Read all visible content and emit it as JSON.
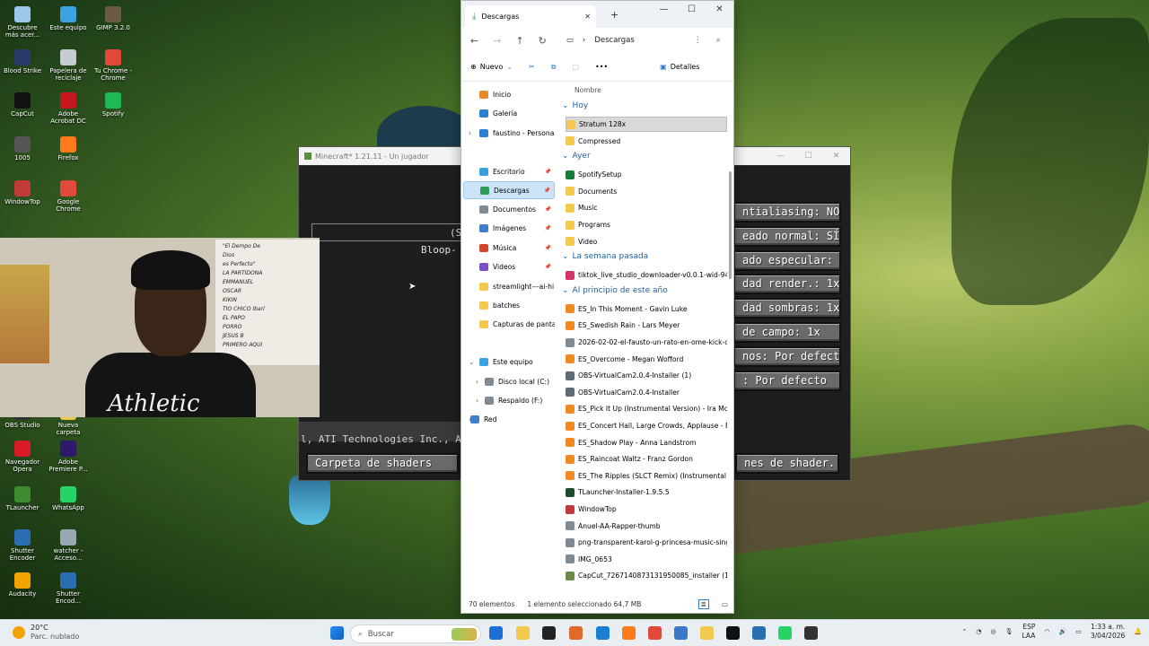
{
  "desktop_icons": [
    {
      "label": "Descubre más acer...",
      "color": "#9cc7e8"
    },
    {
      "label": "Este equipo",
      "color": "#3da2e0"
    },
    {
      "label": "GIMP 3.2.0",
      "color": "#6c5a42"
    },
    {
      "label": "Blood Strike",
      "color": "#2a3a6a"
    },
    {
      "label": "Papelera de reciclaje",
      "color": "#c7ccd3"
    },
    {
      "label": "Tu Chrome - Chrome",
      "color": "#e3493a"
    },
    {
      "label": "CapCut",
      "color": "#111111"
    },
    {
      "label": "Adobe Acrobat DC",
      "color": "#c8161d"
    },
    {
      "label": "Spotify",
      "color": "#1db954"
    },
    {
      "label": "1005",
      "color": "#555555"
    },
    {
      "label": "Firefox",
      "color": "#ff7a1a"
    },
    {
      "label": "WindowTop",
      "color": "#c23b3b"
    },
    {
      "label": "Google Chrome",
      "color": "#e3493a"
    },
    {
      "label": "OBS Studio",
      "color": "#303030"
    },
    {
      "label": "Nueva carpeta",
      "color": "#f2c94c"
    },
    {
      "label": "Navegador Opera",
      "color": "#d81b26"
    },
    {
      "label": "Adobe Premiere P...",
      "color": "#2d1a6b"
    },
    {
      "label": "TLauncher",
      "color": "#3c8b2f"
    },
    {
      "label": "WhatsApp",
      "color": "#25d366"
    },
    {
      "label": "Shutter Encoder",
      "color": "#2a6db0"
    },
    {
      "label": "watcher - Acceso...",
      "color": "#9aa8b4"
    },
    {
      "label": "Audacity",
      "color": "#f3a300"
    },
    {
      "label": "Shutter Encod...",
      "color": "#2a6db0"
    }
  ],
  "minecraft": {
    "title": "Minecraft* 1.21.11 - Un jugador",
    "text_top": "(SH",
    "text_bloop": "Bloop-",
    "text_gpu": "l, ATI Technologies Inc., AM",
    "left_button": "Carpeta de shaders",
    "options": [
      "ntialiasing: NO",
      "eado normal: SÍ",
      "ado especular: SÍ",
      "dad render.: 1x",
      "dad sombras: 1x",
      "de campo: 1x",
      "nos: Por defecto",
      ": Por defecto"
    ],
    "right_button": "nes de shader..."
  },
  "webcam": {
    "poster_lines": [
      "\"El Dempo De",
      "Dios",
      "es Perfecto\"",
      "LA PARTIDONA",
      "EMMANUEL",
      "OSCAR",
      "KIKIN",
      "TIO CHICO Ibarí",
      "EL PAPO",
      "PORRO",
      "JESUS B",
      "PRIMERO AQUI"
    ],
    "shirt": "Athletic"
  },
  "explorer": {
    "tab_title": "Descargas",
    "path": "Descargas",
    "new_label": "Nuevo",
    "details_label": "Detalles",
    "column_name": "Nombre",
    "nav": [
      {
        "label": "Inicio",
        "color": "#e58b2e",
        "pin": false
      },
      {
        "label": "Galería",
        "color": "#2f7fd1",
        "pin": false
      },
      {
        "label": "faustino - Personal",
        "color": "#2f7fd1",
        "pin": false
      },
      {
        "label": "Escritorio",
        "color": "#3aa0e0",
        "pin": true
      },
      {
        "label": "Descargas",
        "color": "#2e9c58",
        "pin": true
      },
      {
        "label": "Documentos",
        "color": "#7f8a95",
        "pin": true
      },
      {
        "label": "Imágenes",
        "color": "#3f7ec9",
        "pin": true
      },
      {
        "label": "Música",
        "color": "#d2462d",
        "pin": true
      },
      {
        "label": "Videos",
        "color": "#7a4fc2",
        "pin": true
      },
      {
        "label": "streamlight---ai-hi",
        "color": "#f2c94c",
        "pin": false
      },
      {
        "label": "batches",
        "color": "#f2c94c",
        "pin": false
      },
      {
        "label": "Capturas de pantall",
        "color": "#f2c94c",
        "pin": false
      },
      {
        "label": "Este equipo",
        "color": "#3da2e0",
        "pin": false
      },
      {
        "label": "Disco local (C:)",
        "color": "#7f8a95",
        "pin": false
      },
      {
        "label": "Respaldo (F:)",
        "color": "#7f8a95",
        "pin": false
      },
      {
        "label": "Red",
        "color": "#3f7ec9",
        "pin": false
      }
    ],
    "groups": [
      {
        "title": "Hoy",
        "items": [
          {
            "name": "Stratum 128x",
            "icon": "#f2c94c"
          },
          {
            "name": "Compressed",
            "icon": "#f2c94c"
          }
        ]
      },
      {
        "title": "Ayer",
        "items": [
          {
            "name": "SpotifySetup",
            "icon": "#1a7a3c"
          },
          {
            "name": "Documents",
            "icon": "#f2c94c"
          },
          {
            "name": "Music",
            "icon": "#f2c94c"
          },
          {
            "name": "Programs",
            "icon": "#f2c94c"
          },
          {
            "name": "Video",
            "icon": "#f2c94c"
          }
        ]
      },
      {
        "title": "La semana pasada",
        "items": [
          {
            "name": "tiktok_live_studio_downloader-v0.0.1-wid-94Z",
            "icon": "#d2336b"
          }
        ]
      },
      {
        "title": "Al principio de este año",
        "items": [
          {
            "name": "ES_In This Moment - Gavin Luke",
            "icon": "#f08a24"
          },
          {
            "name": "ES_Swedish Rain - Lars Meyer",
            "icon": "#f08a24"
          },
          {
            "name": "2026-02-02-el-fausto-un-rato-en-ome-kick-co",
            "icon": "#7f8a95"
          },
          {
            "name": "ES_Overcome - Megan Wofford",
            "icon": "#f08a24"
          },
          {
            "name": "OBS-VirtualCam2.0.4-Installer (1)",
            "icon": "#5f6a78"
          },
          {
            "name": "OBS-VirtualCam2.0.4-Installer",
            "icon": "#5f6a78"
          },
          {
            "name": "ES_Pick It Up (Instrumental Version) - Ira Moor",
            "icon": "#f08a24"
          },
          {
            "name": "ES_Concert Hall, Large Crowds, Applause - Epi",
            "icon": "#f08a24"
          },
          {
            "name": "ES_Shadow Play - Anna Landstrom",
            "icon": "#f08a24"
          },
          {
            "name": "ES_Raincoat Waltz - Franz Gordon",
            "icon": "#f08a24"
          },
          {
            "name": "ES_The Ripples (SLCT Remix) (Instrumental Ver",
            "icon": "#f08a24"
          },
          {
            "name": "TLauncher-Installer-1.9.5.5",
            "icon": "#1b4d2c"
          },
          {
            "name": "WindowTop",
            "icon": "#c23b3b"
          },
          {
            "name": "Anuel-AA-Rapper-thumb",
            "icon": "#7f8a95"
          },
          {
            "name": "png-transparent-karol-g-princesa-music-sing",
            "icon": "#7f8a95"
          },
          {
            "name": "IMG_0653",
            "icon": "#7f8a95"
          },
          {
            "name": "CapCut_7267140873131950085_installer (1)",
            "icon": "#6a8a4a"
          }
        ]
      }
    ],
    "status_count": "70 elementos",
    "status_selected": "1 elemento seleccionado  64,7 MB"
  },
  "taskbar": {
    "weather_temp": "20°C",
    "weather_desc": "Parc. nublado",
    "search_placeholder": "Buscar",
    "lang": "ESP",
    "lang2": "LAA",
    "time": "1:33 a. m.",
    "date": "3/04/2026",
    "apps": [
      "#1d6fd8",
      "#f2c94c",
      "#222",
      "#e06a2b",
      "#1b7fd1",
      "#ff7a1a",
      "#e3493a",
      "#3a78c9",
      "#f2c94c",
      "#111",
      "#2a6db0",
      "#25d366",
      "#333",
      "#1db954",
      "#3c8b2f"
    ]
  }
}
